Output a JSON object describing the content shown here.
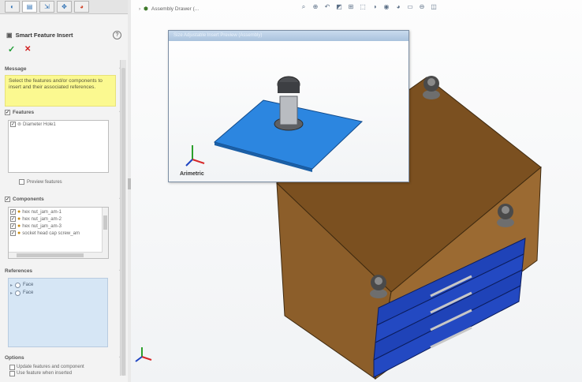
{
  "panel": {
    "title": "Smart Feature Insert",
    "help_label": "?",
    "message": {
      "label": "Message",
      "text": "Select the features and/or components to insert and their associated references."
    },
    "features": {
      "label": "Features",
      "items": [
        {
          "label": "Diameter Hole1"
        }
      ],
      "preview_label": "Preview features"
    },
    "components": {
      "label": "Components",
      "items": [
        {
          "label": "hex nut_jam_am-1"
        },
        {
          "label": "hex nut_jam_am-2"
        },
        {
          "label": "hex nut_jam_am-3"
        },
        {
          "label": "socket head cap screw_am"
        }
      ]
    },
    "references": {
      "label": "References",
      "items": [
        {
          "label": "Face"
        },
        {
          "label": "Face"
        }
      ]
    },
    "options": {
      "label": "Options",
      "items": [
        {
          "label": "Update features and component"
        },
        {
          "label": "Use feature when inserted"
        }
      ]
    }
  },
  "viewport": {
    "tree_title": "Assembly Drawer (..."
  },
  "preview_window": {
    "title": "Size Adjustable Insert Preview (Assembly)",
    "brand": "Arimetric"
  },
  "colors": {
    "message_bg": "#fbf990",
    "references_bg": "#d6e6f5",
    "wood": "#8a5a28",
    "drawer_blue": "#1f43b8",
    "preview_plate": "#2c86e0"
  }
}
